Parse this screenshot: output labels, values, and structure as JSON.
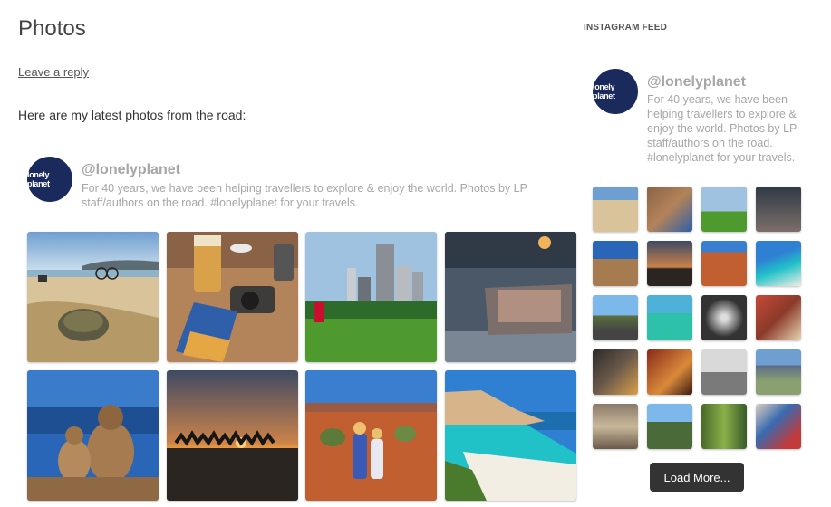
{
  "post": {
    "title": "Photos",
    "leave_reply": "Leave a reply",
    "intro": "Here are my latest photos from the road:"
  },
  "feed": {
    "avatar_text": "lonely planet",
    "handle": "@lonelyplanet",
    "bio": "For 40 years, we have been helping travellers to explore & enjoy the world. Photos by LP staff/authors on the road. #lonelyplanet for your travels.",
    "photos": [
      "beach with tortoise and bicycle",
      "Malta guidebook with beer and camera",
      "city skyline with park",
      "London guidebook on table",
      "monkeys on cliff by the sea",
      "camel caravan at sunset",
      "children in outback desert",
      "turquoise beach coastline"
    ]
  },
  "sidebar": {
    "widget_title": "INSTAGRAM FEED",
    "avatar_text": "lonely planet",
    "handle": "@lonelyplanet",
    "bio": "For 40 years, we have been helping travellers to explore & enjoy the world. Photos by LP staff/authors on the road. #lonelyplanet for your travels.",
    "load_more": "Load More..."
  }
}
